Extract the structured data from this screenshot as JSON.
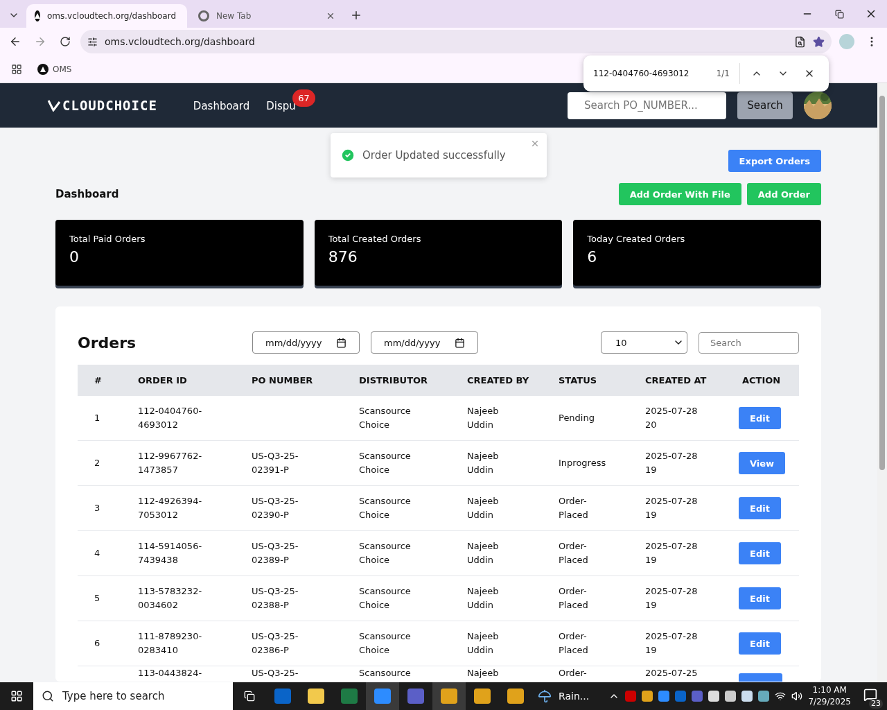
{
  "browser": {
    "tabs": [
      {
        "title": "oms.vcloudtech.org/dashboard",
        "selected": true,
        "kind": "site"
      },
      {
        "title": "New Tab",
        "selected": false,
        "kind": "newtab"
      }
    ],
    "address": "oms.vcloudtech.org/dashboard",
    "bookmarks": [
      "OMS"
    ],
    "find_bar": {
      "query": "112-0404760-4693012",
      "count": "1/1"
    }
  },
  "navbar": {
    "logo": "CLOUDCHOICE",
    "links": [
      {
        "label": "Dashboard"
      },
      {
        "label": "Dispu",
        "badge": "67"
      }
    ],
    "search": {
      "placeholder": "Search PO_NUMBER..."
    },
    "search_button": "Search"
  },
  "toast": {
    "message": "Order Updated successfully"
  },
  "page": {
    "title": "Dashboard",
    "buttons": [
      {
        "label": "Export Orders",
        "kind": "blue"
      },
      {
        "label": "Add Order With File",
        "kind": "green"
      },
      {
        "label": "Add Order",
        "kind": "green"
      }
    ],
    "stats": [
      {
        "label": "Total Paid Orders",
        "value": "0"
      },
      {
        "label": "Total Created Orders",
        "value": "876"
      },
      {
        "label": "Today Created Orders",
        "value": "6"
      }
    ]
  },
  "orders": {
    "title": "Orders",
    "date_from": "mm/dd/yyyy",
    "date_to": "mm/dd/yyyy",
    "page_size": "10",
    "search": {
      "placeholder": "Search"
    },
    "columns": [
      "#",
      "ORDER ID",
      "PO NUMBER",
      "DISTRIBUTOR",
      "CREATED BY",
      "STATUS",
      "CREATED AT",
      "ACTION"
    ],
    "rows": [
      {
        "cells": [
          "1",
          "112-0404760-4693012",
          "",
          "Scansource Choice",
          "Najeeb Uddin",
          "Pending",
          "2025-07-28 20"
        ],
        "action": "Edit"
      },
      {
        "cells": [
          "2",
          "112-9967762-1473857",
          "US-Q3-25-02391-P",
          "Scansource Choice",
          "Najeeb Uddin",
          "Inprogress",
          "2025-07-28 19"
        ],
        "action": "View"
      },
      {
        "cells": [
          "3",
          "112-4926394-7053012",
          "US-Q3-25-02390-P",
          "Scansource Choice",
          "Najeeb Uddin",
          "Order-Placed",
          "2025-07-28 19"
        ],
        "action": "Edit"
      },
      {
        "cells": [
          "4",
          "114-5914056-7439438",
          "US-Q3-25-02389-P",
          "Scansource Choice",
          "Najeeb Uddin",
          "Order-Placed",
          "2025-07-28 19"
        ],
        "action": "Edit"
      },
      {
        "cells": [
          "5",
          "113-5783232-0034602",
          "US-Q3-25-02388-P",
          "Scansource Choice",
          "Najeeb Uddin",
          "Order-Placed",
          "2025-07-28 19"
        ],
        "action": "Edit"
      },
      {
        "cells": [
          "6",
          "111-8789230-0283410",
          "US-Q3-25-02386-P",
          "Scansource Choice",
          "Najeeb Uddin",
          "Order-Placed",
          "2025-07-28 19"
        ],
        "action": "Edit"
      },
      {
        "cells": [
          "",
          "113-0443824-",
          "US-Q3-25-",
          "Scansource",
          "Najeeb",
          "Order-",
          "2025-07-25"
        ]
      }
    ]
  },
  "taskbar": {
    "search": {
      "placeholder": "Type here to search"
    },
    "weather": "Rain...",
    "time": "1:10 AM",
    "date": "7/29/2025",
    "notifications": "23"
  }
}
